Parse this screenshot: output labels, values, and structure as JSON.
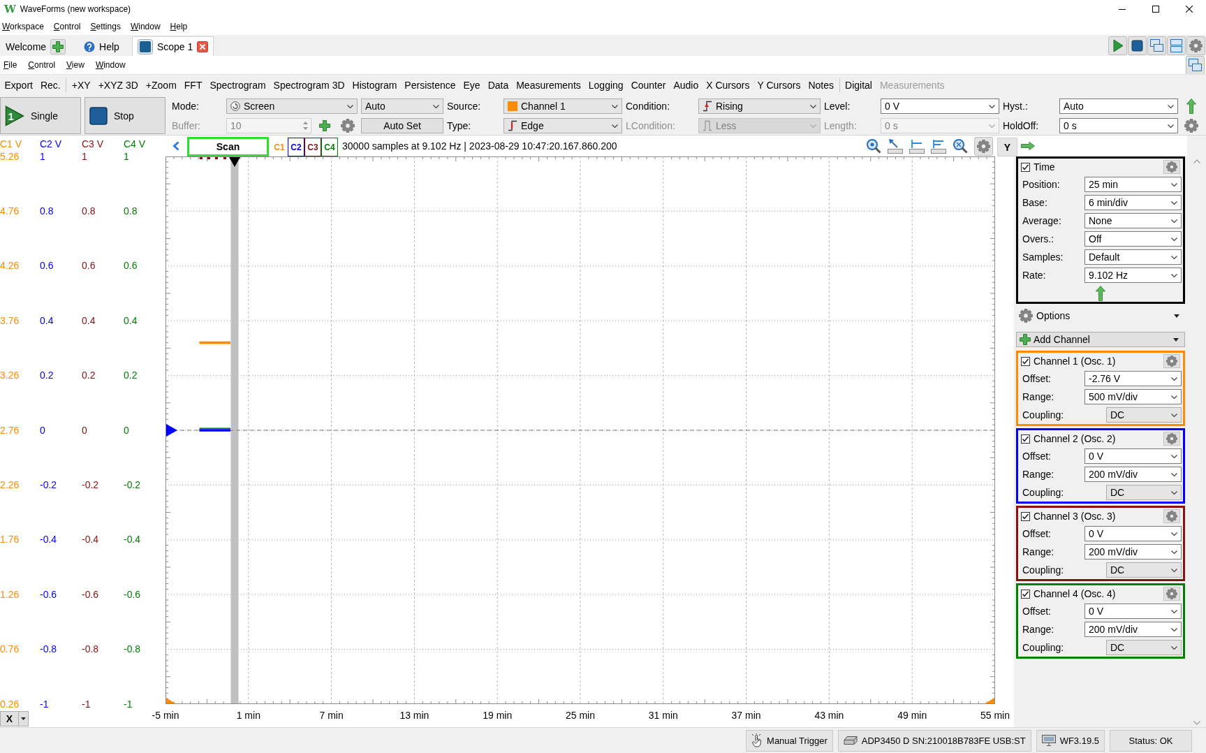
{
  "window": {
    "logo": "W",
    "title": "WaveForms (new workspace)"
  },
  "menu": [
    "Workspace",
    "Control",
    "Settings",
    "Window",
    "Help"
  ],
  "tabs": [
    {
      "label": "Welcome",
      "kind": "welcome",
      "selected": false
    },
    {
      "label": "Help",
      "kind": "help",
      "selected": false
    },
    {
      "label": "Scope 1",
      "kind": "instrument",
      "selected": true
    }
  ],
  "instrument_menu": [
    "File",
    "Control",
    "View",
    "Window"
  ],
  "toolbar": [
    {
      "items": [
        {
          "label": "Export",
          "disabled": false
        },
        {
          "label": "Rec.",
          "disabled": false
        }
      ]
    },
    {
      "items": [
        {
          "label": "+XY",
          "disabled": false
        },
        {
          "label": "+XYZ 3D",
          "disabled": false
        },
        {
          "label": "+Zoom",
          "disabled": false
        },
        {
          "label": "FFT",
          "disabled": false
        },
        {
          "label": "Spectrogram",
          "disabled": false
        },
        {
          "label": "Spectrogram 3D",
          "disabled": false
        },
        {
          "label": "Histogram",
          "disabled": false
        },
        {
          "label": "Persistence",
          "disabled": false
        },
        {
          "label": "Eye",
          "disabled": false
        },
        {
          "label": "Data",
          "disabled": false
        },
        {
          "label": "Measurements",
          "disabled": false
        },
        {
          "label": "Logging",
          "disabled": false
        },
        {
          "label": "Counter",
          "disabled": false
        },
        {
          "label": "Audio",
          "disabled": false
        },
        {
          "label": "X Cursors",
          "disabled": false
        },
        {
          "label": "Y Cursors",
          "disabled": false
        },
        {
          "label": "Notes",
          "disabled": false
        }
      ]
    },
    {
      "items": [
        {
          "label": "Digital",
          "disabled": false
        },
        {
          "label": "Measurements",
          "disabled": true
        }
      ]
    }
  ],
  "acquisition": {
    "single": {
      "label": "Single",
      "badge": "1"
    },
    "stop": {
      "label": "Stop"
    }
  },
  "trigger_rows": [
    [
      {
        "kind": "label",
        "text": "Mode:",
        "disabled": false
      },
      {
        "kind": "select",
        "value": "Screen",
        "disabled": false
      },
      {
        "kind": "select",
        "value": "Auto",
        "disabled": false
      },
      {
        "kind": "label",
        "text": "Source:",
        "disabled": false
      },
      {
        "kind": "select",
        "value": "Channel 1",
        "disabled": false
      },
      {
        "kind": "label",
        "text": "Condition:",
        "disabled": false
      },
      {
        "kind": "select",
        "value": "Rising",
        "disabled": false
      },
      {
        "kind": "label",
        "text": "Level:",
        "disabled": false
      },
      {
        "kind": "input",
        "value": "0 V",
        "disabled": false
      },
      {
        "kind": "label",
        "text": "Hyst.:",
        "disabled": false
      },
      {
        "kind": "input",
        "value": "Auto",
        "disabled": false
      },
      {
        "kind": "arrow",
        "disabled": false
      }
    ],
    [
      {
        "kind": "label",
        "text": "Buffer:",
        "disabled": true
      },
      {
        "kind": "spinner",
        "value": "10",
        "disabled": true
      },
      {
        "kind": "add",
        "disabled": false
      },
      {
        "kind": "gear",
        "disabled": false
      },
      {
        "kind": "button",
        "label": "Auto Set",
        "disabled": false
      },
      {
        "kind": "label",
        "text": "Type:",
        "disabled": false
      },
      {
        "kind": "select",
        "value": "Edge",
        "disabled": false
      },
      {
        "kind": "label",
        "text": "LCondition:",
        "disabled": true
      },
      {
        "kind": "select",
        "value": "Less",
        "disabled": true
      },
      {
        "kind": "label",
        "text": "Length:",
        "disabled": true
      },
      {
        "kind": "input",
        "value": "0 s",
        "disabled": true
      },
      {
        "kind": "label",
        "text": "HoldOff:",
        "disabled": false
      },
      {
        "kind": "input",
        "value": "0 s",
        "disabled": false
      },
      {
        "kind": "gear",
        "disabled": false
      }
    ]
  ],
  "scope": {
    "scan": {
      "label": "Scan"
    },
    "channel_toggles": [
      {
        "label": "C1",
        "color": "#ff8c00",
        "selected": false
      },
      {
        "label": "C2",
        "color": "#0000ff",
        "selected": true
      },
      {
        "label": "C3",
        "color": "#8b1010",
        "selected": true
      },
      {
        "label": "C4",
        "color": "#008000",
        "selected": true
      }
    ],
    "info": "30000 samples at 9.102 Hz | 2023-08-29 10:47:20.167.860.200",
    "y_axes": [
      {
        "header": "C1 V",
        "color": "#ff8c00",
        "labels": [
          "5.26",
          "4.76",
          "4.26",
          "3.76",
          "3.26",
          "2.76",
          "2.26",
          "1.76",
          "1.26",
          "0.76",
          "0.26"
        ]
      },
      {
        "header": "C2 V",
        "color": "#0000ff",
        "labels": [
          "1",
          "0.8",
          "0.6",
          "0.4",
          "0.2",
          "0",
          "-0.2",
          "-0.4",
          "-0.6",
          "-0.8",
          "-1"
        ]
      },
      {
        "header": "C3 V",
        "color": "#8b1010",
        "labels": [
          "1",
          "0.8",
          "0.6",
          "0.4",
          "0.2",
          "0",
          "-0.2",
          "-0.4",
          "-0.6",
          "-0.8",
          "-1"
        ]
      },
      {
        "header": "C4 V",
        "color": "#008000"
      }
    ],
    "chart_data": {
      "type": "line",
      "x": [
        -2.55,
        -0.3
      ],
      "xlim": [
        -5,
        55
      ],
      "ylim": [
        -1,
        1
      ],
      "grid": true,
      "xticks": [
        {
          "value": -5,
          "label": "-5 min"
        },
        {
          "value": 1,
          "label": "1 min"
        },
        {
          "value": 7,
          "label": "7 min"
        },
        {
          "value": 13,
          "label": "13 min"
        },
        {
          "value": 19,
          "label": "19 min"
        },
        {
          "value": 25,
          "label": "25 min"
        },
        {
          "value": 31,
          "label": "31 min"
        },
        {
          "value": 37,
          "label": "37 min"
        },
        {
          "value": 43,
          "label": "43 min"
        },
        {
          "value": 49,
          "label": "49 min"
        },
        {
          "value": 55,
          "label": "55 min"
        }
      ],
      "yticks": [
        {
          "value": 1,
          "label": "1"
        },
        {
          "value": 0.8,
          "label": "0.8"
        },
        {
          "value": 0.6,
          "label": "0.6"
        },
        {
          "value": 0.4,
          "label": "0.4"
        },
        {
          "value": 0.2,
          "label": "0.2"
        },
        {
          "value": 0,
          "label": "0"
        },
        {
          "value": -0.2,
          "label": "-0.2"
        },
        {
          "value": -0.4,
          "label": "-0.4"
        },
        {
          "value": -0.6,
          "label": "-0.6"
        },
        {
          "value": -0.8,
          "label": "-0.8"
        },
        {
          "value": -1,
          "label": "-1"
        }
      ],
      "series": [
        {
          "color": "#ff8c00",
          "values": [
            0.32,
            0.32
          ]
        },
        {
          "color": "#0000ff",
          "values": [
            0,
            0
          ]
        },
        {
          "color": "#008000",
          "values": [
            0.007,
            0.007
          ]
        }
      ],
      "ref_lines": [
        {
          "axis": "x",
          "value": 0
        },
        {
          "axis": "y",
          "value": 0
        }
      ]
    },
    "x_button": {
      "label": "X"
    }
  },
  "side_panel": {
    "axis_button": {
      "label": "Y"
    },
    "time": {
      "title": "Time",
      "checked": true,
      "fields": [
        {
          "label": "Position:",
          "value": "25 min",
          "kind": "input"
        },
        {
          "label": "Base:",
          "value": "6 min/div",
          "kind": "input"
        },
        {
          "label": "Average:",
          "value": "None",
          "kind": "input"
        },
        {
          "label": "Overs.:",
          "value": "Off",
          "kind": "input"
        },
        {
          "label": "Samples:",
          "value": "Default",
          "kind": "input"
        },
        {
          "label": "Rate:",
          "value": "9.102 Hz",
          "kind": "input"
        }
      ]
    },
    "options": {
      "label": "Options"
    },
    "add_channel": {
      "label": "Add Channel"
    },
    "channels": [
      {
        "title": "Channel 1 (Osc. 1)",
        "checked": true,
        "color": "#ff8c00",
        "fields": [
          {
            "label": "Offset:",
            "value": "-2.76 V",
            "kind": "input"
          },
          {
            "label": "Range:",
            "value": "500 mV/div",
            "kind": "input"
          },
          {
            "label": "Coupling:",
            "value": "DC",
            "kind": "select"
          }
        ]
      },
      {
        "title": "Channel 2 (Osc. 2)",
        "checked": true,
        "color": "#0000ff",
        "fields": [
          {
            "label": "Offset:",
            "value": "0 V",
            "kind": "input"
          },
          {
            "label": "Range:",
            "value": "200 mV/div",
            "kind": "input"
          },
          {
            "label": "Coupling:",
            "value": "DC",
            "kind": "select"
          }
        ]
      },
      {
        "title": "Channel 3 (Osc. 3)",
        "checked": true,
        "color": "#8b1010",
        "fields": [
          {
            "label": "Offset:",
            "value": "0 V",
            "kind": "input"
          },
          {
            "label": "Range:",
            "value": "200 mV/div",
            "kind": "input"
          },
          {
            "label": "Coupling:",
            "value": "DC",
            "kind": "select"
          }
        ]
      },
      {
        "title": "Channel 4 (Osc. 4)",
        "checked": true,
        "color": "#008000",
        "fields": [
          {
            "label": "Offset:",
            "value": "0 V",
            "kind": "input"
          },
          {
            "label": "Range:",
            "value": "200 mV/div",
            "kind": "input"
          },
          {
            "label": "Coupling:",
            "value": "DC",
            "kind": "select"
          }
        ]
      }
    ]
  },
  "status_bar": [
    {
      "label": "Manual Trigger",
      "kind": "trigger"
    },
    {
      "label": "ADP3450 D SN:210018B783FE USB:ST",
      "kind": "device"
    },
    {
      "label": "WF3.19.5",
      "kind": "version"
    },
    {
      "label": "Status: OK",
      "kind": "status"
    }
  ]
}
